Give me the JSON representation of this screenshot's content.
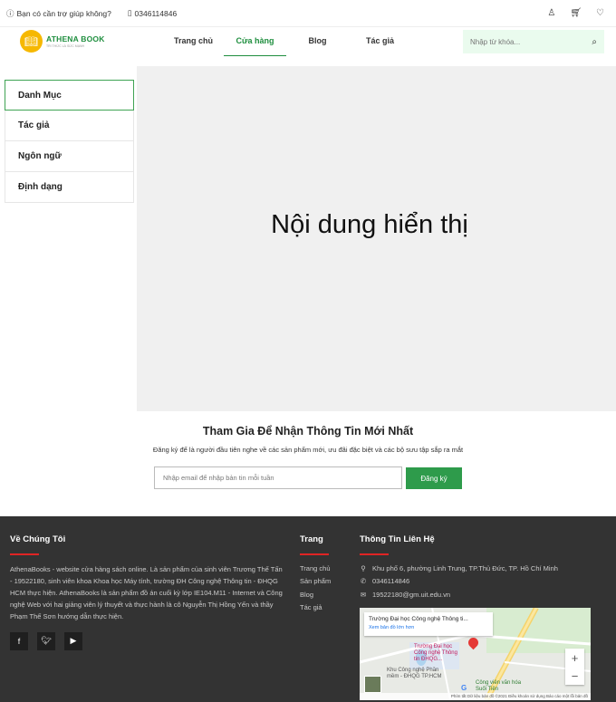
{
  "topbar": {
    "help_text": "Bạn có cần trợ giúp không?",
    "phone": "0346114846"
  },
  "header": {
    "logo_name": "ATHENA BOOK",
    "logo_sub": "TRI THỨC LÀ SỨC MẠNH",
    "nav": [
      {
        "label": "Trang chủ"
      },
      {
        "label": "Cửa hàng"
      },
      {
        "label": "Blog"
      },
      {
        "label": "Tác giả"
      }
    ],
    "active_nav": "Cửa hàng",
    "search_placeholder": "Nhập từ khóa..."
  },
  "sidebar": {
    "items": [
      {
        "label": "Danh Mục"
      },
      {
        "label": "Tác giả"
      },
      {
        "label": "Ngôn ngữ"
      },
      {
        "label": "Định dạng"
      }
    ]
  },
  "content": {
    "placeholder_text": "Nội dung hiển thị"
  },
  "newsletter": {
    "title": "Tham Gia Để Nhận Thông Tin Mới Nhất",
    "desc": "Đăng ký để là người đầu tiên nghe về các sản phẩm mới, ưu đãi đặc biệt và các bộ sưu tập sắp ra mắt",
    "input_placeholder": "Nhập email để nhập bản tin mỗi tuần",
    "button_label": "Đăng ký"
  },
  "footer": {
    "about": {
      "title": "Về Chúng Tôi",
      "desc": "AthenaBooks - website cửa hàng sách online. Là sản phẩm của sinh viên Trương Thế Tấn - 19522180, sinh viên khoa Khoa học Máy tính, trường ĐH Công nghệ Thông tin - ĐHQG HCM thực hiện. AthenaBooks là sản phẩm đồ án cuối kỳ lớp IE104.M11 - Internet và Công nghệ Web với hai giảng viên lý thuyết và thực hành là cô Nguyễn Thị Hồng Yến và thầy Phạm Thế Sơn hướng dẫn thực hiện."
    },
    "pages": {
      "title": "Trang",
      "items": [
        "Trang chủ",
        "Sản phẩm",
        "Blog",
        "Tác giả"
      ]
    },
    "contact": {
      "title": "Thông Tin Liên Hệ",
      "address": "Khu phố 6, phường Linh Trung, TP.Thủ Đức, TP. Hồ Chí Minh",
      "phone": "0346114846",
      "email": "19522180@gm.uit.edu.vn"
    },
    "map": {
      "card_title": "Trường Đại học Công nghệ Thông ti...",
      "card_link": "Xem bản đồ lớn hơn",
      "place1": "Trường Đại học Công nghệ Thông tin ĐHQG...",
      "place2": "Khu Công nghệ Phần mềm - ĐHQG TP.HCM",
      "place3": "Công viên văn hóa Suối Tiên",
      "attribution": "Phím tắt   Dữ liệu bản đồ ©2021   Điều khoản sử dụng   Báo cáo một lỗi bản đồ"
    }
  }
}
